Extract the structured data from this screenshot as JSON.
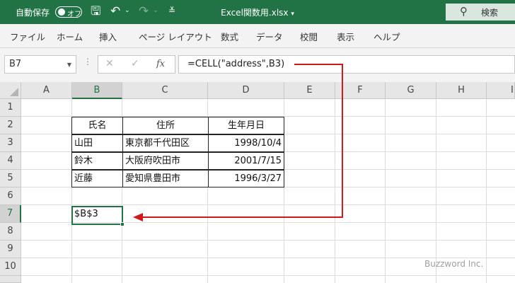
{
  "titlebar": {
    "autosave_label": "自動保存",
    "autosave_state": "オフ",
    "filename": "Excel関数用.xlsx",
    "search_label": "検索"
  },
  "ribbon": {
    "tabs": [
      "ファイル",
      "ホーム",
      "挿入",
      "ページ レイアウト",
      "数式",
      "データ",
      "校閲",
      "表示",
      "ヘルプ"
    ]
  },
  "formula_bar": {
    "name_box": "B7",
    "formula": "=CELL(\"address\",B3)",
    "fx_label": "fx"
  },
  "sheet": {
    "columns": [
      "A",
      "B",
      "C",
      "D",
      "E",
      "F",
      "G",
      "H",
      "I"
    ],
    "rows": [
      "1",
      "2",
      "3",
      "4",
      "5",
      "6",
      "7",
      "8",
      "9",
      "10"
    ],
    "selected_column": "B",
    "selected_row": "7",
    "table": {
      "headers": [
        "氏名",
        "住所",
        "生年月日"
      ],
      "rows": [
        [
          "山田",
          "東京都千代田区",
          "1998/10/4"
        ],
        [
          "鈴木",
          "大阪府吹田市",
          "2001/7/15"
        ],
        [
          "近藤",
          "愛知県豊田市",
          "1996/3/27"
        ]
      ]
    },
    "active_cell_value": "$B$3"
  },
  "annotation": {
    "arrow_color": "#d0191d"
  },
  "watermark": "Buzzword Inc.",
  "colors": {
    "excel_green": "#217346"
  }
}
